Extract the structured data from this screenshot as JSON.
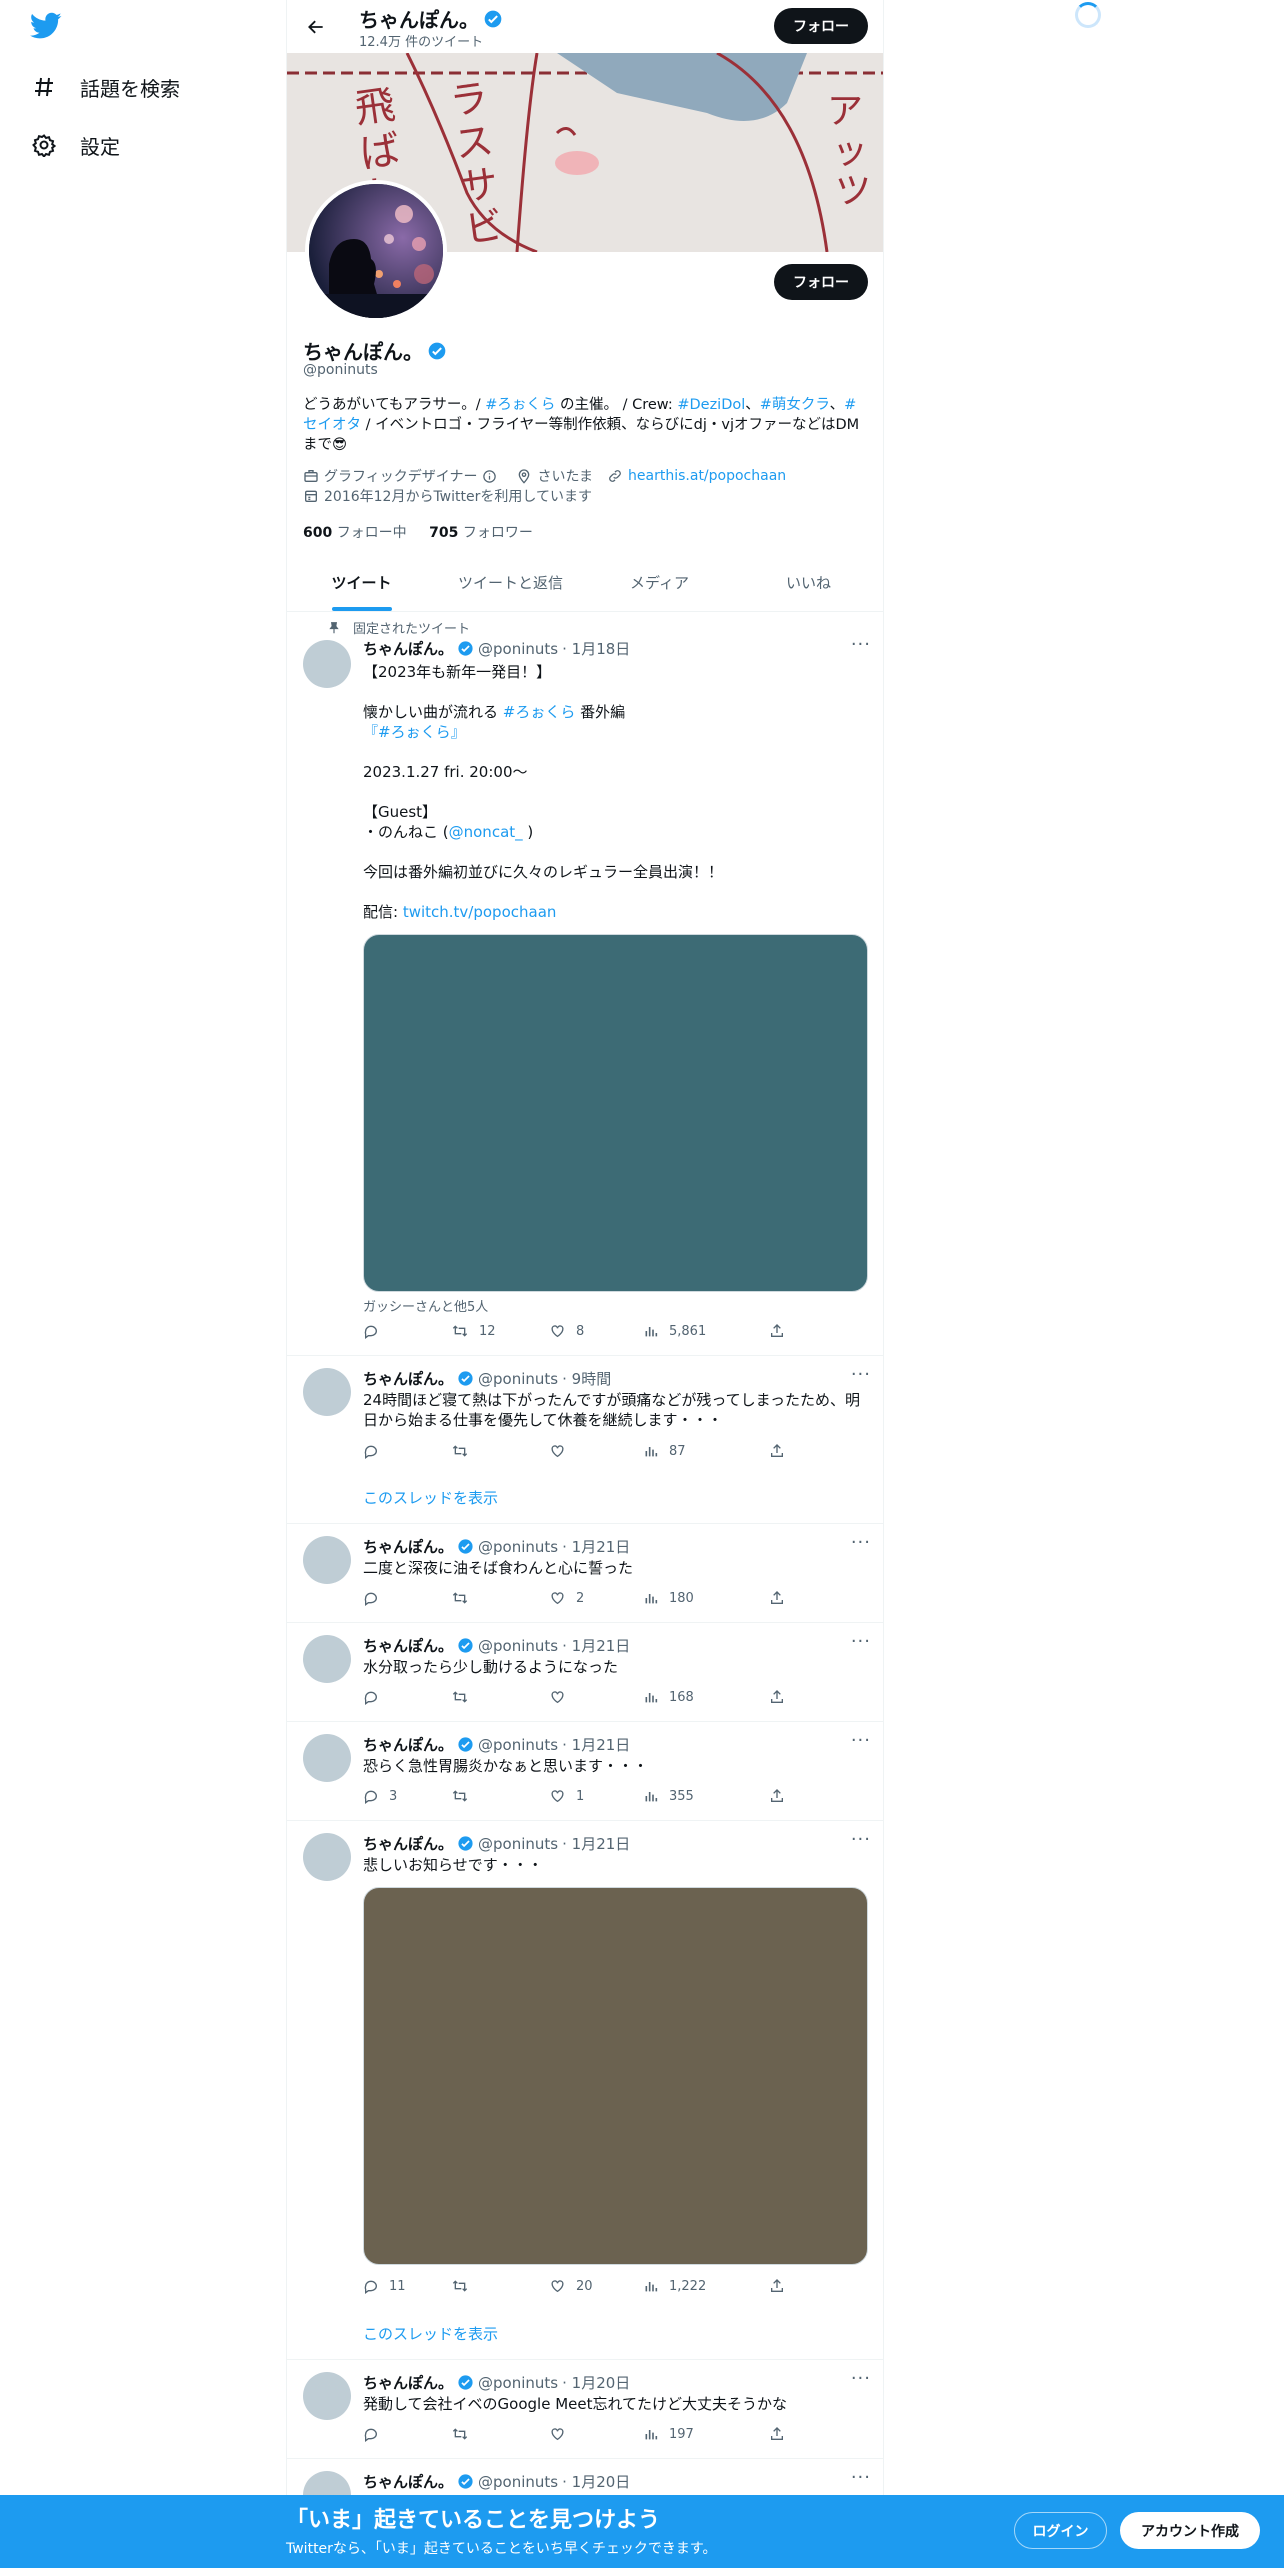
{
  "nav": {
    "explore_label": "話題を検索",
    "settings_label": "設定"
  },
  "header": {
    "name": "ちゃんぽん。",
    "tweet_count": "12.4万 件のツイート",
    "follow_label": "フォロー"
  },
  "profile": {
    "name": "ちゃんぽん。",
    "handle": "@poninuts",
    "follow_label": "フォロー",
    "bio": {
      "p1": "どうあがいてもアラサー。/ ",
      "tag1": "#ろぉくら",
      "p2": " の主催。 / Crew: ",
      "tag2": "#DeziDol",
      "sep1": "、",
      "tag3": "#萌女クラ",
      "sep2": "、",
      "tag4": "#セイオタ",
      "p3": " / イベントロゴ・フライヤー等制作依頼、ならびにdj・vjオファーなどはDMまで😎"
    },
    "category": "グラフィックデザイナー",
    "location": "さいたま",
    "website": "hearthis.at/popochaan",
    "joined": "2016年12月からTwitterを利用しています",
    "following_count": "600",
    "following_label": "フォロー中",
    "followers_count": "705",
    "followers_label": "フォロワー"
  },
  "tabs": [
    "ツイート",
    "ツイートと返信",
    "メディア",
    "いいね"
  ],
  "pinned_label": "固定されたツイート",
  "tweets": [
    {
      "name": "ちゃんぽん。",
      "handle": "@poninuts",
      "time": "· 1月18日",
      "lines": [
        "【2023年も新年一発目！】",
        "",
        "懐かしい曲が流れる ",
        "#ろぉくら",
        " 番外編",
        "『#ろぉくら』",
        "",
        "2023.1.27 fri. 20:00～",
        "",
        "【Guest】",
        "・のんねこ (",
        "@noncat_",
        " )",
        "",
        "今回は番外編初並びに久々のレギュラー全員出演！！",
        "",
        "配信: ",
        "twitch.tv/popochaan"
      ],
      "media_color": "#3d6b75",
      "tagged": "ガッシーさんと他5人",
      "replies": "",
      "retweets": "12",
      "likes": "8",
      "views": "5,861"
    },
    {
      "name": "ちゃんぽん。",
      "handle": "@poninuts",
      "time": "· 9時間",
      "text": "24時間ほど寝て熱は下がったんですが頭痛などが残ってしまったため、明日から始まる仕事を優先して休養を継続します・・・",
      "replies": "",
      "retweets": "",
      "likes": "",
      "views": "87",
      "show_thread": "このスレッドを表示"
    },
    {
      "name": "ちゃんぽん。",
      "handle": "@poninuts",
      "time": "· 1月21日",
      "text": "二度と深夜に油そば食わんと心に誓った",
      "replies": "",
      "retweets": "",
      "likes": "2",
      "views": "180"
    },
    {
      "name": "ちゃんぽん。",
      "handle": "@poninuts",
      "time": "· 1月21日",
      "text": "水分取ったら少し動けるようになった",
      "replies": "",
      "retweets": "",
      "likes": "",
      "views": "168"
    },
    {
      "name": "ちゃんぽん。",
      "handle": "@poninuts",
      "time": "· 1月21日",
      "text": "恐らく急性胃腸炎かなぁと思います・・・",
      "replies": "3",
      "retweets": "",
      "likes": "1",
      "views": "355"
    },
    {
      "name": "ちゃんぽん。",
      "handle": "@poninuts",
      "time": "· 1月21日",
      "text": "悲しいお知らせです・・・",
      "media_color": "#6b6250",
      "replies": "11",
      "retweets": "",
      "likes": "20",
      "views": "1,222",
      "show_thread": "このスレッドを表示"
    },
    {
      "name": "ちゃんぽん。",
      "handle": "@poninuts",
      "time": "· 1月20日",
      "text": "発動して会社イベのGoogle Meet忘れてたけど大丈夫そうかな",
      "replies": "",
      "retweets": "",
      "likes": "",
      "views": "197"
    },
    {
      "name": "ちゃんぽん。",
      "handle": "@poninuts",
      "time": "· 1月20日"
    }
  ],
  "bottom_bar": {
    "title": "「いま」起きていることを見つけよう",
    "subtitle": "Twitterなら、「いま」起きていることをいち早くチェックできます。",
    "login": "ログイン",
    "signup": "アカウント作成"
  },
  "colors": {
    "accent": "#1d9bf0",
    "dark_button": "#0f1419",
    "secondary_text": "#536471"
  },
  "icons": [
    "twitter-logo-icon",
    "hashtag-icon",
    "gear-icon",
    "back-arrow-icon",
    "verified-badge-icon",
    "briefcase-icon",
    "info-icon",
    "location-pin-icon",
    "link-icon",
    "calendar-icon",
    "pin-icon",
    "more-icon",
    "reply-icon",
    "retweet-icon",
    "like-icon",
    "views-icon",
    "share-icon",
    "loading-spinner-icon"
  ]
}
